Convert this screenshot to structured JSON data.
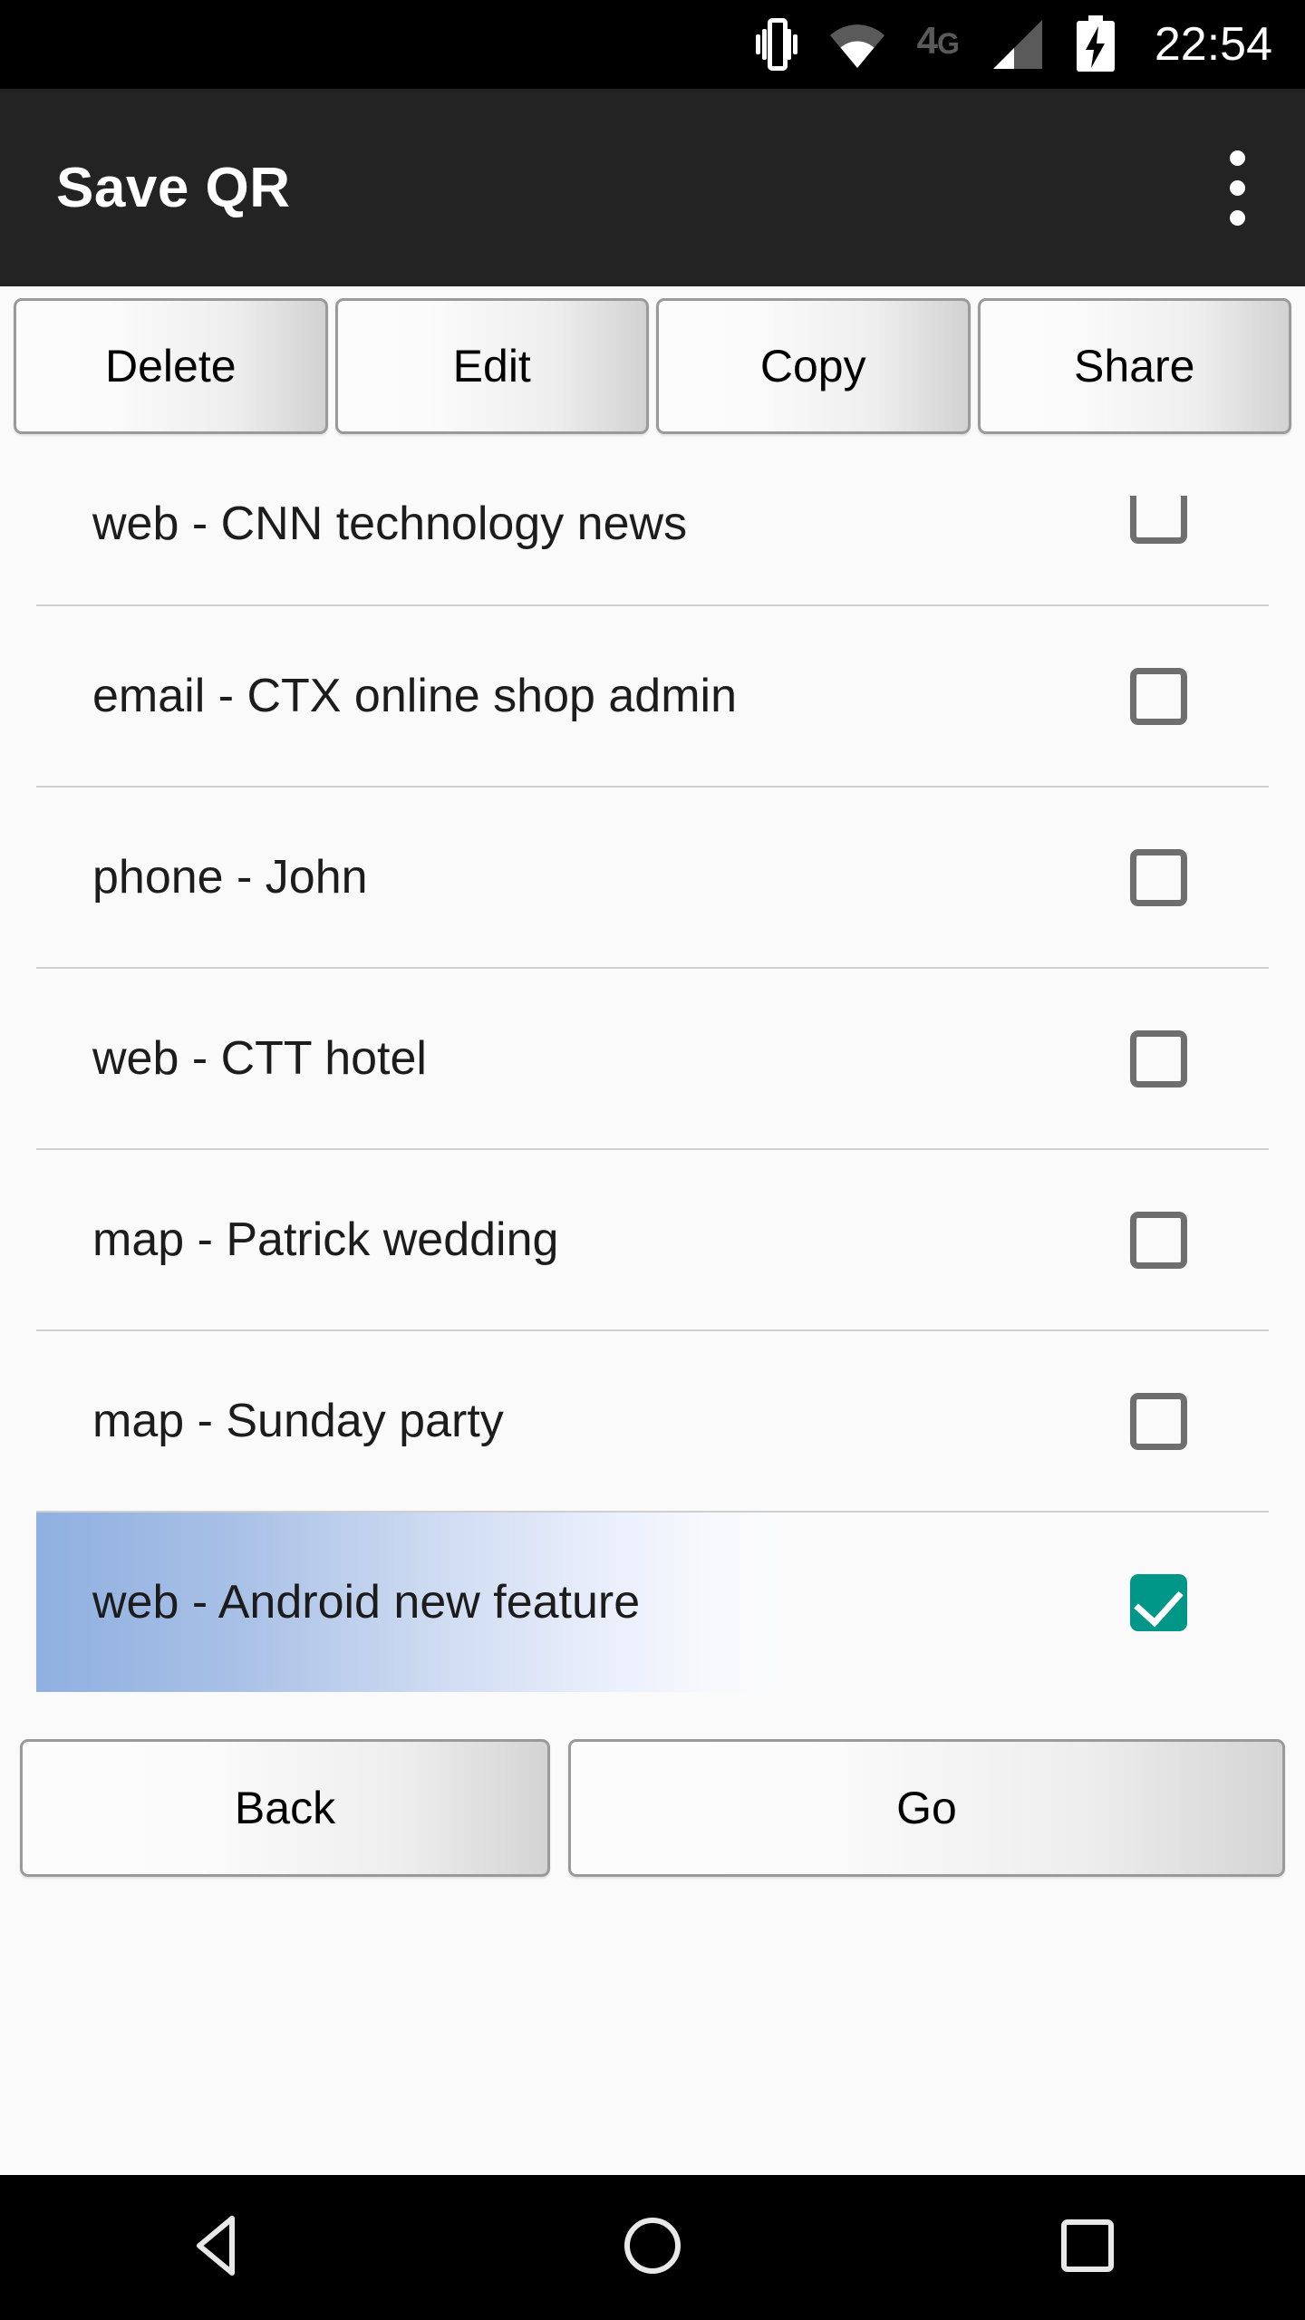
{
  "status_bar": {
    "clock": "22:54",
    "network_label": "4G",
    "icons": [
      "vibrate-icon",
      "wifi-icon",
      "network-4g-icon",
      "signal-icon",
      "battery-charging-icon"
    ],
    "background_color": "#000000",
    "text_color": "#ffffff"
  },
  "action_bar": {
    "title": "Save QR",
    "overflow_menu": "overflow-menu-icon",
    "background_color": "#232323"
  },
  "toolbar": {
    "buttons": [
      {
        "label": "Delete",
        "name": "delete-button"
      },
      {
        "label": "Edit",
        "name": "edit-button"
      },
      {
        "label": "Copy",
        "name": "copy-button"
      },
      {
        "label": "Share",
        "name": "share-button"
      }
    ]
  },
  "list": {
    "items": [
      {
        "label": "web - CNN technology news",
        "checked": false,
        "selected": false
      },
      {
        "label": "email - CTX online shop admin",
        "checked": false,
        "selected": false
      },
      {
        "label": "phone - John",
        "checked": false,
        "selected": false
      },
      {
        "label": "web - CTT hotel",
        "checked": false,
        "selected": false
      },
      {
        "label": "map - Patrick wedding",
        "checked": false,
        "selected": false
      },
      {
        "label": "map - Sunday party",
        "checked": false,
        "selected": false
      },
      {
        "label": "web - Android new feature",
        "checked": true,
        "selected": true
      }
    ],
    "checked_color": "#009688",
    "unchecked_border_color": "#6e6e6e",
    "selected_highlight_color": "#8FB0E0",
    "divider_color": "#cfcfcf"
  },
  "footer": {
    "back_label": "Back",
    "go_label": "Go"
  },
  "nav_bar": {
    "back": "nav-back-icon",
    "home": "nav-home-icon",
    "recents": "nav-recents-icon",
    "background_color": "#000000"
  }
}
